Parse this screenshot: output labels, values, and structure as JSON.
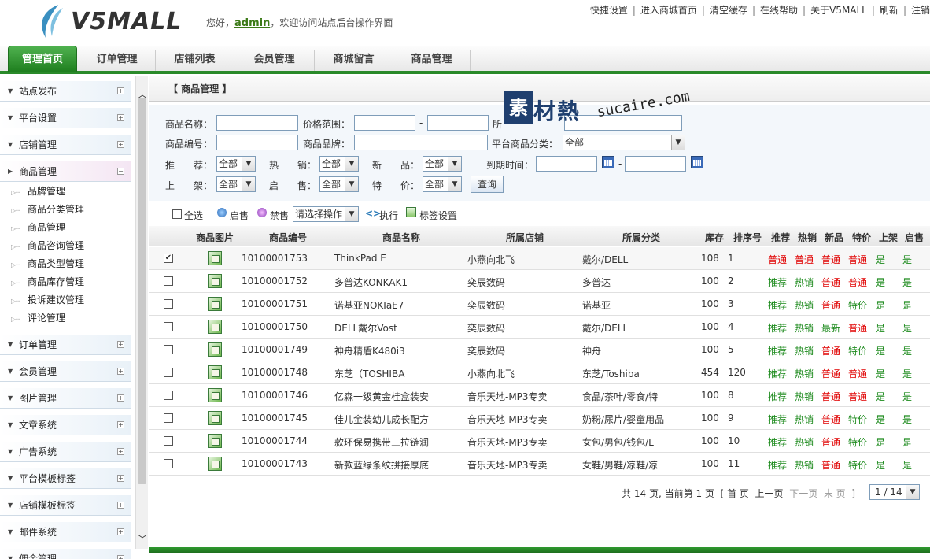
{
  "header": {
    "logo_text": "V5MALL",
    "welcome_prefix": "您好，",
    "admin_name": "admin",
    "welcome_suffix": "，欢迎访问站点后台操作界面",
    "toplinks": [
      "快捷设置",
      "进入商城首页",
      "清空缓存",
      "在线帮助",
      "关于V5MALL",
      "刷新",
      "注销"
    ]
  },
  "nav": {
    "tabs": [
      "管理首页",
      "订单管理",
      "店铺列表",
      "会员管理",
      "商城留言",
      "商品管理"
    ]
  },
  "sidebar": {
    "items": [
      {
        "label": "站点发布",
        "pm": "+"
      },
      {
        "label": "平台设置",
        "pm": "+"
      },
      {
        "label": "店铺管理",
        "pm": "+"
      },
      {
        "label": "商品管理",
        "pm": "−"
      },
      {
        "label": "订单管理",
        "pm": "+"
      },
      {
        "label": "会员管理",
        "pm": "+"
      },
      {
        "label": "图片管理",
        "pm": "+"
      },
      {
        "label": "文章系统",
        "pm": "+"
      },
      {
        "label": "广告系统",
        "pm": "+"
      },
      {
        "label": "平台模板标签",
        "pm": "+"
      },
      {
        "label": "店铺模板标签",
        "pm": "+"
      },
      {
        "label": "邮件系统",
        "pm": "+"
      },
      {
        "label": "佣金管理",
        "pm": "+"
      }
    ],
    "sub_items": [
      "品牌管理",
      "商品分类管理",
      "商品管理",
      "商品咨询管理",
      "商品类型管理",
      "商品库存管理",
      "投诉建议管理",
      "评论管理"
    ]
  },
  "panel": {
    "title": "【 商品管理 】"
  },
  "filters": {
    "name_label": "商品名称：",
    "price_label": "价格范围：",
    "price_sep": "-",
    "store_label": "所",
    "code_label": "商品编号：",
    "brand_label": "商品品牌：",
    "category_label": "平台商品分类：",
    "category_value": "全部",
    "recommend_label": "推　　荐：",
    "hot_label": "热　　销：",
    "new_label": "新　　品：",
    "expire_label": "到期时间：",
    "date_sep": "-",
    "shelf_label": "上　　架：",
    "sale_label": "启　　售：",
    "special_label": "特　　价：",
    "all": "全部",
    "query_button": "查询"
  },
  "actions": {
    "select_all": "全选",
    "enable_sale": "启售",
    "disable_sale": "禁售",
    "operation_select": "请选择操作",
    "execute": "执行",
    "tag_settings": "标签设置"
  },
  "table": {
    "headers": [
      "商品图片",
      "商品编号",
      "商品名称",
      "所属店铺",
      "所属分类",
      "库存",
      "排序号",
      "推荐",
      "热销",
      "新品",
      "特价",
      "上架",
      "启售"
    ],
    "rows": [
      {
        "checked": true,
        "code": "10100001753",
        "name": "ThinkPad E",
        "store": "小燕向北飞",
        "category": "戴尔/DELL",
        "stock": "108",
        "sort": "1",
        "rec": "普通",
        "hot": "普通",
        "new": "普通",
        "special": "普通",
        "shelf": "是",
        "sale": "是"
      },
      {
        "checked": false,
        "code": "10100001752",
        "name": "多普达KONKAK1",
        "store": "奕辰数码",
        "category": "多普达",
        "stock": "100",
        "sort": "2",
        "rec": "推荐",
        "hot": "热销",
        "new": "普通",
        "special": "普通",
        "shelf": "是",
        "sale": "是"
      },
      {
        "checked": false,
        "code": "10100001751",
        "name": "诺基亚NOKIaE7",
        "store": "奕辰数码",
        "category": "诺基亚",
        "stock": "100",
        "sort": "3",
        "rec": "推荐",
        "hot": "热销",
        "new": "普通",
        "special": "特价",
        "shelf": "是",
        "sale": "是"
      },
      {
        "checked": false,
        "code": "10100001750",
        "name": "DELL戴尔Vost",
        "store": "奕辰数码",
        "category": "戴尔/DELL",
        "stock": "100",
        "sort": "4",
        "rec": "推荐",
        "hot": "热销",
        "new": "最新",
        "special": "普通",
        "shelf": "是",
        "sale": "是"
      },
      {
        "checked": false,
        "code": "10100001749",
        "name": "神舟精盾K480i3",
        "store": "奕辰数码",
        "category": "神舟",
        "stock": "100",
        "sort": "5",
        "rec": "推荐",
        "hot": "热销",
        "new": "普通",
        "special": "特价",
        "shelf": "是",
        "sale": "是"
      },
      {
        "checked": false,
        "code": "10100001748",
        "name": "东芝（TOSHIBA",
        "store": "小燕向北飞",
        "category": "东芝/Toshiba",
        "stock": "454",
        "sort": "120",
        "rec": "推荐",
        "hot": "热销",
        "new": "普通",
        "special": "普通",
        "shelf": "是",
        "sale": "是"
      },
      {
        "checked": false,
        "code": "10100001746",
        "name": "亿森一级黄金桂盒装安",
        "store": "音乐天地-MP3专卖",
        "category": "食品/茶叶/零食/特",
        "stock": "100",
        "sort": "8",
        "rec": "推荐",
        "hot": "热销",
        "new": "普通",
        "special": "普通",
        "shelf": "是",
        "sale": "是"
      },
      {
        "checked": false,
        "code": "10100001745",
        "name": "佳儿金装幼儿成长配方",
        "store": "音乐天地-MP3专卖",
        "category": "奶粉/尿片/婴童用品",
        "stock": "100",
        "sort": "9",
        "rec": "推荐",
        "hot": "热销",
        "new": "普通",
        "special": "特价",
        "shelf": "是",
        "sale": "是"
      },
      {
        "checked": false,
        "code": "10100001744",
        "name": "款环保易携带三拉链润",
        "store": "音乐天地-MP3专卖",
        "category": "女包/男包/钱包/L",
        "stock": "100",
        "sort": "10",
        "rec": "推荐",
        "hot": "热销",
        "new": "普通",
        "special": "特价",
        "shelf": "是",
        "sale": "是"
      },
      {
        "checked": false,
        "code": "10100001743",
        "name": "新款蓝绿条纹拼接厚底",
        "store": "音乐天地-MP3专卖",
        "category": "女鞋/男鞋/凉鞋/凉",
        "stock": "100",
        "sort": "11",
        "rec": "推荐",
        "hot": "热销",
        "new": "普通",
        "special": "特价",
        "shelf": "是",
        "sale": "是"
      }
    ]
  },
  "pager": {
    "summary": "共 14 页, 当前第 1 页",
    "open": "[",
    "first": "首 页",
    "prev": "上一页",
    "next": "下一页",
    "last": "末 页",
    "close": "]",
    "select_value": "1 / 14"
  },
  "watermark": {
    "box": "素",
    "cn": "材熱",
    "en": "sucaire.com"
  },
  "colors": {
    "accent_green": "#2a8a2a",
    "flag_red": "#e00000",
    "flag_green": "#1c8a1c"
  }
}
